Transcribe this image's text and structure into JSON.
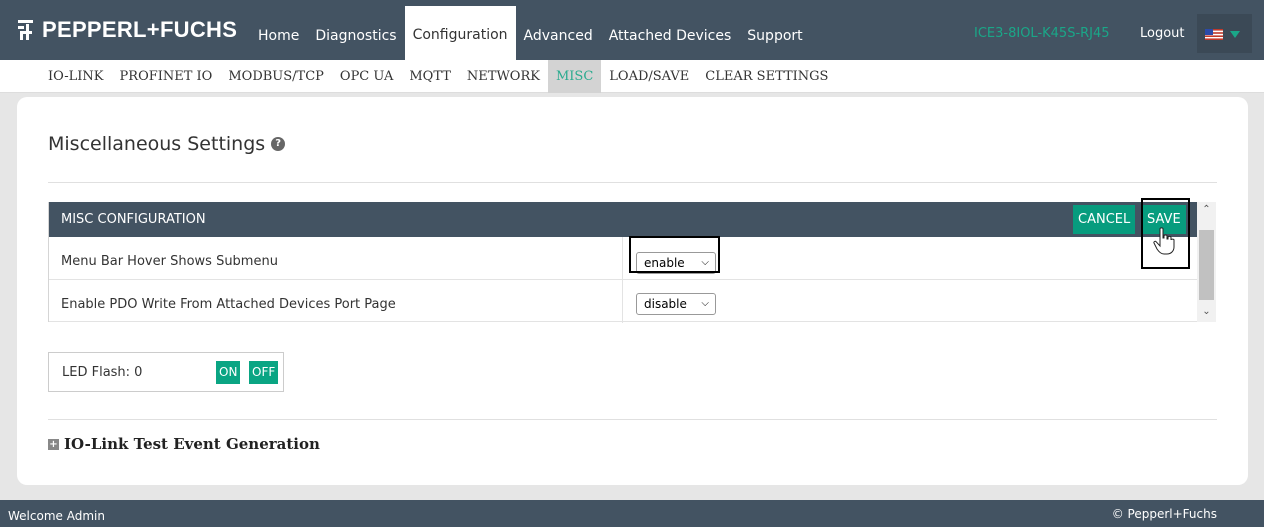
{
  "header": {
    "brand": "PEPPERL+FUCHS",
    "nav": [
      "Home",
      "Diagnostics",
      "Configuration",
      "Advanced",
      "Attached Devices",
      "Support"
    ],
    "active_nav": "Configuration",
    "device_name": "ICE3-8IOL-K45S-RJ45",
    "logout": "Logout",
    "accent_color": "#1aa788",
    "bar_color": "#435362"
  },
  "subnav": {
    "items": [
      "IO-LINK",
      "PROFINET IO",
      "MODBUS/TCP",
      "OPC UA",
      "MQTT",
      "NETWORK",
      "MISC",
      "LOAD/SAVE",
      "CLEAR SETTINGS"
    ],
    "active": "MISC"
  },
  "page": {
    "title": "Miscellaneous Settings"
  },
  "misc_config": {
    "header": "MISC CONFIGURATION",
    "cancel_label": "CANCEL",
    "save_label": "SAVE",
    "rows": [
      {
        "label": "Menu Bar Hover Shows Submenu",
        "value": "enable"
      },
      {
        "label": "Enable PDO Write From Attached Devices Port Page",
        "value": "disable"
      }
    ]
  },
  "led": {
    "label": "LED Flash: 0",
    "on_label": "ON",
    "off_label": "OFF"
  },
  "test_events": {
    "label": "IO-Link Test Event Generation"
  },
  "footer": {
    "welcome": "Welcome Admin",
    "copyright": "© Pepperl+Fuchs"
  }
}
